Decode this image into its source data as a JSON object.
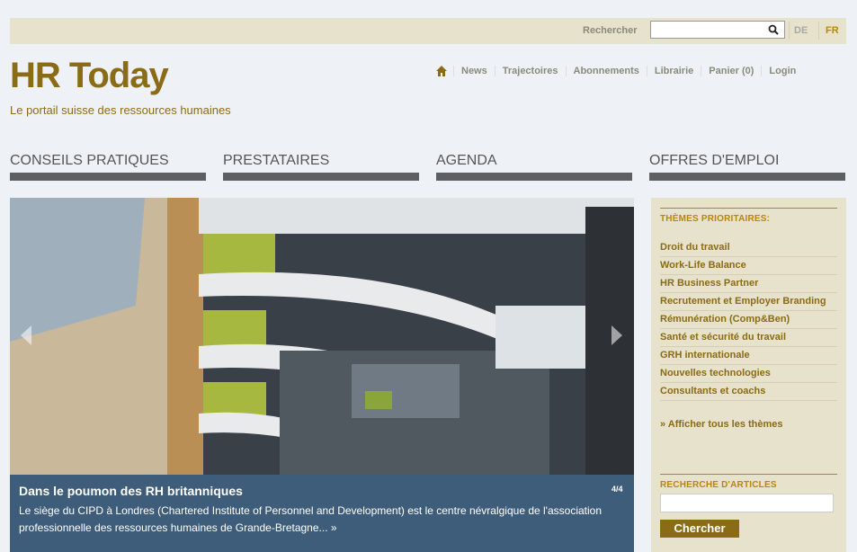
{
  "header": {
    "search_label": "Rechercher",
    "lang_de": "DE",
    "lang_fr": "FR",
    "logo": "HR Today",
    "tagline": "Le portail suisse des ressources humaines",
    "topnav": [
      "News",
      "Trajectoires",
      "Abonnements",
      "Librairie",
      "Panier (0)",
      "Login"
    ]
  },
  "mainnav": [
    "CONSEILS PRATIQUES",
    "PRESTATAIRES",
    "AGENDA",
    "OFFRES D'EMPLOI"
  ],
  "hero": {
    "title": "Dans le poumon des RH britanniques",
    "text": "Le siège du CIPD à Londres (Chartered Institute of Personnel and Development) est le centre névralgique de l'association professionnelle des ressources humaines de Grande-Bretagne... »",
    "counter": "4/4"
  },
  "sidebar": {
    "themes_heading": "THÈMES PRIORITAIRES:",
    "themes": [
      "Droit du travail",
      "Work-Life Balance",
      "HR Business Partner",
      "Recrutement et Employer Branding",
      "Rémunération (Comp&Ben)",
      "Santé et sécurité du travail",
      "GRH internationale",
      "Nouvelles technologies",
      "Consultants et coachs"
    ],
    "all_themes": "» Afficher tous les thèmes",
    "search_heading": "RECHERCHE D'ARTICLES",
    "search_button": "Chercher"
  },
  "colors": {
    "brand": "#8a6b16",
    "nav_bar": "#5d5f63",
    "caption_bg": "#3e5d7a",
    "sidebar_bg": "#e7e2cb"
  }
}
